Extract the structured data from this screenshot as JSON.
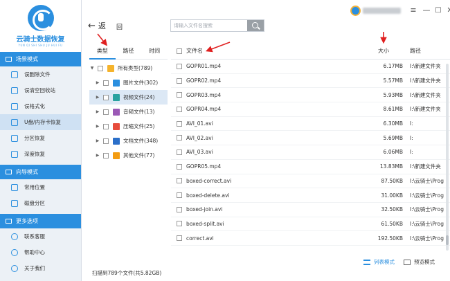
{
  "app": {
    "name": "云骑士数据恢复",
    "subtitle": "YUN QI SHI SHU JU HUI FU"
  },
  "sidebar": {
    "sections": [
      {
        "title": "场景模式",
        "items": [
          "误删除文件",
          "误清空回收站",
          "误格式化",
          "U盘/内存卡恢复",
          "分区恢复",
          "深度恢复"
        ]
      },
      {
        "title": "向导模式",
        "items": [
          "常用位置",
          "磁盘分区"
        ]
      },
      {
        "title": "更多选项",
        "items": [
          "联系客服",
          "帮助中心",
          "关于我们"
        ]
      }
    ],
    "active_item": "U盘/内存卡恢复"
  },
  "toolbar": {
    "back_label": "返",
    "home_label": "回",
    "search_placeholder": "请输入文件名搜索"
  },
  "tree": {
    "tabs": [
      "类型",
      "路径",
      "时间"
    ],
    "rows": [
      {
        "label": "所有类型(789)",
        "color": "#f5b32c"
      },
      {
        "label": "图片文件(302)",
        "color": "#2b8fdf"
      },
      {
        "label": "视频文件(24)",
        "color": "#2aa2a0"
      },
      {
        "label": "音频文件(13)",
        "color": "#9b59b6"
      },
      {
        "label": "压缩文件(25)",
        "color": "#e74c3c"
      },
      {
        "label": "文档文件(348)",
        "color": "#2b6fc9"
      },
      {
        "label": "其他文件(77)",
        "color": "#f39c12"
      }
    ]
  },
  "list": {
    "columns": {
      "name": "文件名",
      "size": "大小",
      "path": "路径"
    },
    "rows": [
      {
        "name": "GOPR01.mp4",
        "size": "6.17MB",
        "path": "I:\\新建文件夹"
      },
      {
        "name": "GOPR02.mp4",
        "size": "5.57MB",
        "path": "I:\\新建文件夹"
      },
      {
        "name": "GOPR03.mp4",
        "size": "5.93MB",
        "path": "I:\\新建文件夹"
      },
      {
        "name": "GOPR04.mp4",
        "size": "8.61MB",
        "path": "I:\\新建文件夹"
      },
      {
        "name": "AVI_01.avi",
        "size": "6.30MB",
        "path": "I:"
      },
      {
        "name": "AVI_02.avi",
        "size": "5.69MB",
        "path": "I:"
      },
      {
        "name": "AVI_03.avi",
        "size": "6.06MB",
        "path": "I:"
      },
      {
        "name": "GOPR05.mp4",
        "size": "13.83MB",
        "path": "I:\\新建文件夹"
      },
      {
        "name": "boxed-correct.avi",
        "size": "87.50KB",
        "path": "I:\\云骑士\\Prog"
      },
      {
        "name": "boxed-delete.avi",
        "size": "31.00KB",
        "path": "I:\\云骑士\\Prog"
      },
      {
        "name": "boxed-join.avi",
        "size": "32.50KB",
        "path": "I:\\云骑士\\Prog"
      },
      {
        "name": "boxed-split.avi",
        "size": "61.50KB",
        "path": "I:\\云骑士\\Prog"
      },
      {
        "name": "correct.avi",
        "size": "192.50KB",
        "path": "I:\\云骑士\\Prog"
      }
    ]
  },
  "footer": {
    "status": "扫描到789个文件(共5.82GB)",
    "list_view": "列表模式",
    "preview_view": "预览模式"
  },
  "colors": {
    "accent": "#2b8fdf",
    "annotation": "#e02020"
  }
}
